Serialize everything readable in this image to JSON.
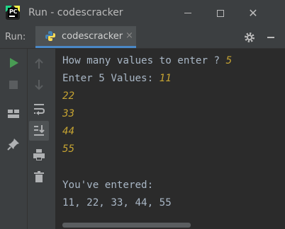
{
  "window": {
    "title": "Run - codescracker",
    "close_glyph": "✕"
  },
  "toolbar": {
    "run_label": "Run:",
    "tab_label": "codescracker",
    "tab_close": "×"
  },
  "console": {
    "prompt1": "How many values to enter ? ",
    "count": "5",
    "prompt2": "Enter 5 Values: ",
    "values": [
      "11",
      "22",
      "33",
      "44",
      "55"
    ],
    "result_label": "You've entered:",
    "result": "11, 22, 33, 44, 55"
  },
  "icons": {
    "toolbar": [
      "pycharm-logo",
      "python-icon",
      "gear-icon",
      "hide-icon"
    ],
    "sidebar": [
      "run-icon",
      "stop-icon",
      "layout-icon",
      "pin-icon",
      "up-arrow-icon",
      "down-arrow-icon",
      "soft-wrap-icon",
      "scroll-to-end-icon",
      "print-icon",
      "trash-icon"
    ]
  },
  "colors": {
    "run_green": "#499c54",
    "input_text": "#c5a332",
    "output_text": "#a9b7c6",
    "tab_underline": "#4a88c7"
  }
}
